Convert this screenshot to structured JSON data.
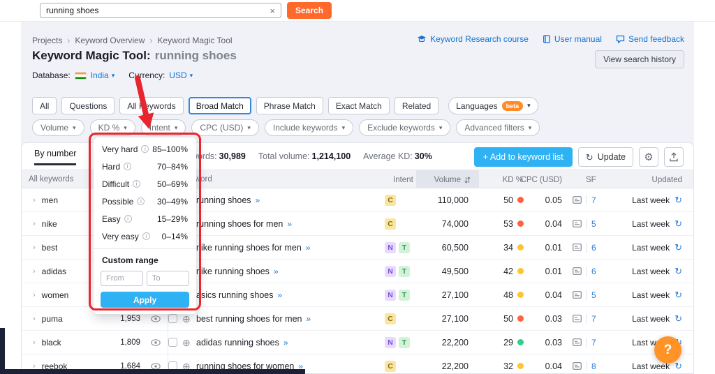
{
  "colors": {
    "search_button_orange": "#ff692b",
    "primary_blue": "#2eb2f4",
    "link_blue": "#1173d4",
    "annotation_red": "#e8252e",
    "help_orange": "#ff9327"
  },
  "icons": {
    "search_clear": "×",
    "caret_down": "▾",
    "breadcrumb_separator": "›",
    "group_chevron": "›",
    "add_circle": "⊕",
    "keyword_arrows": "»",
    "refresh": "↻",
    "gear": "⚙",
    "info": "i"
  },
  "topbar": {
    "search_value": "running shoes",
    "search_button": "Search"
  },
  "breadcrumb": {
    "items": [
      "Projects",
      "Keyword Overview",
      "Keyword Magic Tool"
    ]
  },
  "header_links": [
    {
      "label": "Keyword Research course",
      "icon": "graduation-cap-icon"
    },
    {
      "label": "User manual",
      "icon": "book-icon"
    },
    {
      "label": "Send feedback",
      "icon": "feedback-icon"
    }
  ],
  "title": {
    "tool": "Keyword Magic Tool:",
    "query": "running shoes"
  },
  "view_search_history": "View search history",
  "meta": {
    "database_label": "Database:",
    "database_value": "India",
    "currency_label": "Currency:",
    "currency_value": "USD"
  },
  "match_tabs": [
    "All",
    "Questions",
    "All Keywords",
    "Broad Match",
    "Phrase Match",
    "Exact Match",
    "Related"
  ],
  "active_match_tab": "Broad Match",
  "languages": {
    "label": "Languages",
    "badge": "beta"
  },
  "filter_dropdowns": [
    "Volume",
    "KD %",
    "Intent",
    "CPC (USD)",
    "Include keywords",
    "Exclude keywords",
    "Advanced filters"
  ],
  "kd_menu": {
    "options": [
      {
        "label": "Very hard",
        "range": "85–100%"
      },
      {
        "label": "Hard",
        "range": "70–84%"
      },
      {
        "label": "Difficult",
        "range": "50–69%"
      },
      {
        "label": "Possible",
        "range": "30–49%"
      },
      {
        "label": "Easy",
        "range": "15–29%"
      },
      {
        "label": "Very easy",
        "range": "0–14%"
      }
    ],
    "custom_range_label": "Custom range",
    "from_placeholder": "From",
    "to_placeholder": "To",
    "apply_label": "Apply"
  },
  "toolbar": {
    "by_number_tab": "By number",
    "summary": [
      {
        "label": "All keywords:",
        "value": "30,989"
      },
      {
        "label": "Total volume:",
        "value": "1,214,100"
      },
      {
        "label": "Average KD:",
        "value": "30%"
      }
    ],
    "add_button": "+ Add to keyword list",
    "update_button": "Update"
  },
  "sidebar": {
    "header": "All keywords",
    "groups": [
      {
        "label": "men",
        "count": ""
      },
      {
        "label": "nike",
        "count": ""
      },
      {
        "label": "best",
        "count": ""
      },
      {
        "label": "adidas",
        "count": ""
      },
      {
        "label": "women",
        "count": ""
      },
      {
        "label": "puma",
        "count": "1,953"
      },
      {
        "label": "black",
        "count": "1,809"
      },
      {
        "label": "reebok",
        "count": "1,684"
      }
    ]
  },
  "table": {
    "headers": {
      "keyword": "Keyword",
      "intent": "Intent",
      "volume": "Volume",
      "kd": "KD %",
      "cpc": "CPC (USD)",
      "sf": "SF",
      "updated": "Updated"
    },
    "intent_colors": {
      "C": {
        "bg": "#f9e6a0",
        "fg": "#8a6a12"
      },
      "N": {
        "bg": "#e7dafb",
        "fg": "#7a4fdb"
      },
      "T": {
        "bg": "#d4f1da",
        "fg": "#2f9e53"
      }
    },
    "rows": [
      {
        "keyword": "running shoes",
        "intents": [
          "C"
        ],
        "volume": "110,000",
        "kd": "50",
        "kd_color": "#ff6240",
        "cpc": "0.05",
        "sf": "7",
        "updated": "Last week"
      },
      {
        "keyword": "running shoes for men",
        "intents": [
          "C"
        ],
        "volume": "74,000",
        "kd": "53",
        "kd_color": "#ff6240",
        "cpc": "0.04",
        "sf": "5",
        "updated": "Last week"
      },
      {
        "keyword": "nike running shoes for men",
        "intents": [
          "N",
          "T"
        ],
        "volume": "60,500",
        "kd": "34",
        "kd_color": "#ffc531",
        "cpc": "0.01",
        "sf": "6",
        "updated": "Last week"
      },
      {
        "keyword": "nike running shoes",
        "intents": [
          "N",
          "T"
        ],
        "volume": "49,500",
        "kd": "42",
        "kd_color": "#ffc531",
        "cpc": "0.01",
        "sf": "6",
        "updated": "Last week"
      },
      {
        "keyword": "asics running shoes",
        "intents": [
          "N",
          "T"
        ],
        "volume": "27,100",
        "kd": "48",
        "kd_color": "#ffc531",
        "cpc": "0.04",
        "sf": "5",
        "updated": "Last week"
      },
      {
        "keyword": "best running shoes for men",
        "intents": [
          "C"
        ],
        "volume": "27,100",
        "kd": "50",
        "kd_color": "#ff6240",
        "cpc": "0.03",
        "sf": "7",
        "updated": "Last week"
      },
      {
        "keyword": "adidas running shoes",
        "intents": [
          "N",
          "T"
        ],
        "volume": "22,200",
        "kd": "29",
        "kd_color": "#33cd8c",
        "cpc": "0.03",
        "sf": "7",
        "updated": "Last week"
      },
      {
        "keyword": "running shoes for women",
        "intents": [
          "C"
        ],
        "volume": "22,200",
        "kd": "32",
        "kd_color": "#ffc531",
        "cpc": "0.04",
        "sf": "8",
        "updated": "Last week"
      }
    ]
  },
  "help_button": "?"
}
